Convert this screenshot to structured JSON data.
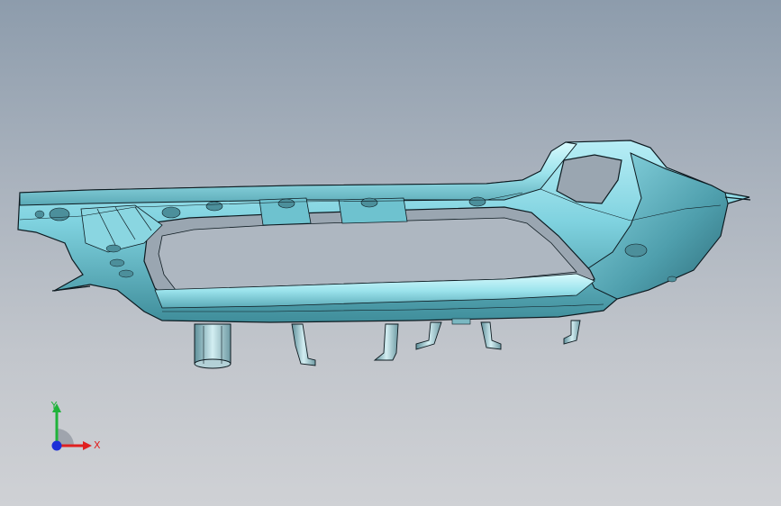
{
  "viewport": {
    "background_top": "#8d9cac",
    "background_bottom": "#cfd1d5"
  },
  "model": {
    "name": "bumper-part-model",
    "surface_color": "#7fd2df",
    "highlight_color": "#c9f4fa",
    "shadow_color": "#2d6b78",
    "edge_color": "#0d1a20"
  },
  "triad": {
    "x_label": "X",
    "y_label": "Y",
    "x_color": "#e02020",
    "y_color": "#1fb33a",
    "z_color": "#1c2fd8"
  }
}
